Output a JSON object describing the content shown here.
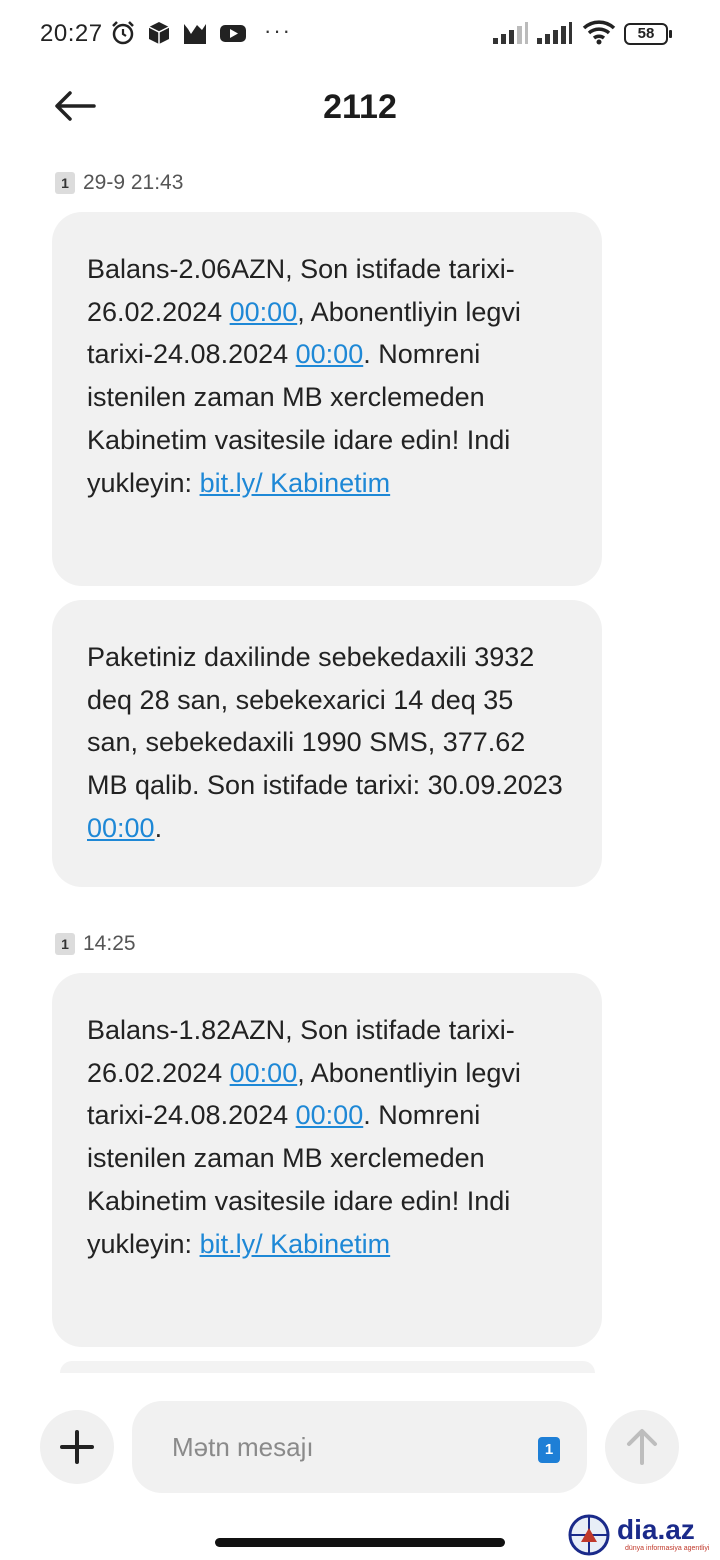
{
  "status_bar": {
    "time": "20:27",
    "left_icons": [
      "alarm-icon",
      "package-icon",
      "image-notification-icon",
      "youtube-icon"
    ],
    "more": "···",
    "battery": "58"
  },
  "header": {
    "title": "2112",
    "back_icon": "arrow-left-icon"
  },
  "messages": [
    {
      "timestamp": "29-9 21:43",
      "sim": "1",
      "bubbles": [
        {
          "segments": [
            {
              "text": "Balans-2.06AZN, Son istifade tarixi-26.02.2024 "
            },
            {
              "text": "00:00",
              "link": true
            },
            {
              "text": ", Abonentliyin legvi tarixi-24.08.2024 "
            },
            {
              "text": "00:00",
              "link": true
            },
            {
              "text": ". Nomreni istenilen zaman MB xerclemeden Kabinetim vasitesile idare edin! Indi yukleyin: "
            },
            {
              "text": "bit.ly/ Kabinetim",
              "link": true
            }
          ]
        },
        {
          "segments": [
            {
              "text": "Paketiniz daxilinde sebekedaxili 3932 deq 28 san, sebekexarici 14 deq 35 san, sebekedaxili 1990 SMS, 377.62 MB qalib. Son istifade tarixi: 30.09.2023 "
            },
            {
              "text": "00:00",
              "link": true
            },
            {
              "text": "."
            }
          ]
        }
      ]
    },
    {
      "timestamp": "14:25",
      "sim": "1",
      "bubbles": [
        {
          "segments": [
            {
              "text": "Balans-1.82AZN, Son istifade tarixi-26.02.2024 "
            },
            {
              "text": "00:00",
              "link": true
            },
            {
              "text": ", Abonentliyin legvi tarixi-24.08.2024 "
            },
            {
              "text": "00:00",
              "link": true
            },
            {
              "text": ". Nomreni istenilen zaman MB xerclemeden Kabinetim vasitesile idare edin! Indi yukleyin: "
            },
            {
              "text": "bit.ly/ Kabinetim",
              "link": true
            }
          ]
        }
      ]
    }
  ],
  "compose": {
    "placeholder": "Mətn mesajı",
    "sim": "1",
    "add_icon": "plus-icon",
    "send_icon": "arrow-up-icon"
  },
  "watermark": {
    "text": "dia.az",
    "subtitle": "dünya informasiya agentliyi"
  },
  "colors": {
    "link": "#1e88d6",
    "bubble": "#f1f1f1",
    "sim_chip": "#1e7fd6"
  }
}
